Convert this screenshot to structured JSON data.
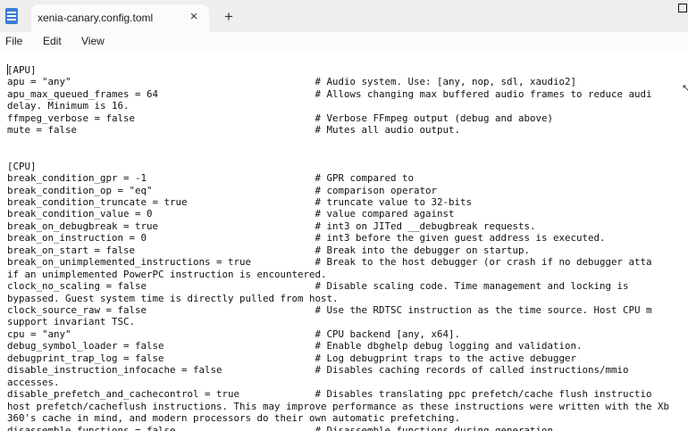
{
  "window": {
    "tab_title": "xenia-canary.config.toml",
    "close_glyph": "×",
    "new_tab_glyph": "+",
    "icons": [
      "notepad-icon",
      "close-icon",
      "plus-icon",
      "maximize-icon"
    ]
  },
  "menu": {
    "file": "File",
    "edit": "Edit",
    "view": "View"
  },
  "editor": {
    "lines": [
      "[APU]",
      "apu = \"any\"                                          # Audio system. Use: [any, nop, sdl, xaudio2]",
      "apu_max_queued_frames = 64                           # Allows changing max buffered audio frames to reduce audi",
      "delay. Minimum is 16.",
      "ffmpeg_verbose = false                               # Verbose FFmpeg output (debug and above)",
      "mute = false                                         # Mutes all audio output.",
      "",
      "",
      "[CPU]",
      "break_condition_gpr = -1                             # GPR compared to",
      "break_condition_op = \"eq\"                            # comparison operator",
      "break_condition_truncate = true                      # truncate value to 32-bits",
      "break_condition_value = 0                            # value compared against",
      "break_on_debugbreak = true                           # int3 on JITed __debugbreak requests.",
      "break_on_instruction = 0                             # int3 before the given guest address is executed.",
      "break_on_start = false                               # Break into the debugger on startup.",
      "break_on_unimplemented_instructions = true           # Break to the host debugger (or crash if no debugger atta",
      "if an unimplemented PowerPC instruction is encountered.",
      "clock_no_scaling = false                             # Disable scaling code. Time management and locking is",
      "bypassed. Guest system time is directly pulled from host.",
      "clock_source_raw = false                             # Use the RDTSC instruction as the time source. Host CPU m",
      "support invariant TSC.",
      "cpu = \"any\"                                          # CPU backend [any, x64].",
      "debug_symbol_loader = false                          # Enable dbghelp debug logging and validation.",
      "debugprint_trap_log = false                          # Log debugprint traps to the active debugger",
      "disable_instruction_infocache = false                # Disables caching records of called instructions/mmio",
      "accesses.",
      "disable_prefetch_and_cachecontrol = true             # Disables translating ppc prefetch/cache flush instructio",
      "host prefetch/cacheflush instructions. This may improve performance as these instructions were written with the Xb",
      "360's cache in mind, and modern processors do their own automatic prefetching.",
      "disassemble_functions = false                        # Disassemble functions during generation."
    ]
  }
}
